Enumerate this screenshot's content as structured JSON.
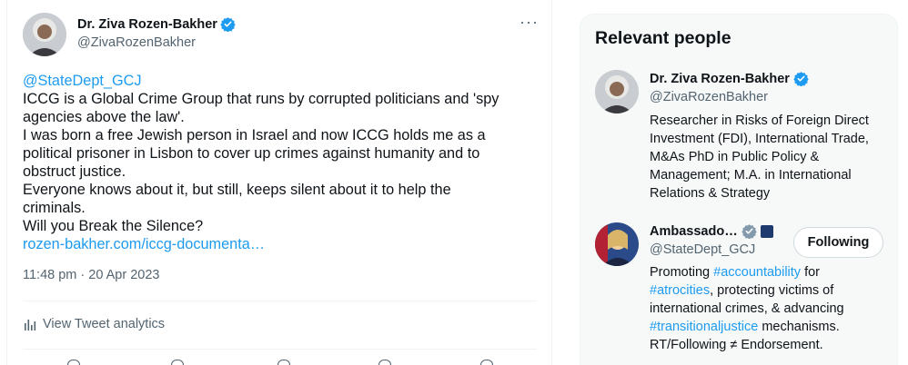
{
  "tweet": {
    "author_name": "Dr. Ziva Rozen-Bakher",
    "author_handle": "@ZivaRozenBakher",
    "more_label": "···",
    "lines": [
      {
        "text": "@StateDept_GCJ",
        "link": true
      },
      {
        "text": "ICCG is a Global Crime Group that runs by corrupted politicians and 'spy",
        "link": false
      },
      {
        "text": "agencies above the law'.",
        "link": false
      },
      {
        "text": "I was born a free Jewish person in Israel and now ICCG holds me as a",
        "link": false
      },
      {
        "text": "political prisoner in Lisbon to cover up crimes against humanity and to",
        "link": false
      },
      {
        "text": "obstruct justice.",
        "link": false
      },
      {
        "text": "Everyone knows about it, but still, keeps silent about it to help the",
        "link": false
      },
      {
        "text": "criminals.",
        "link": false
      },
      {
        "text": "Will you Break the Silence?",
        "link": false
      },
      {
        "text": "rozen-bakher.com/iccg-documenta…",
        "link": true
      }
    ],
    "timestamp": "11:48 pm · 20 Apr 2023",
    "analytics_label": "View Tweet analytics"
  },
  "relevant_people": {
    "title": "Relevant people",
    "people": [
      {
        "name": "Dr. Ziva Rozen-Bakher",
        "handle": "@ZivaRozenBakher",
        "bio_lines": [
          "Researcher in Risks of Foreign Direct",
          "Investment (FDI), International Trade,",
          "M&As PhD in Public Policy &",
          "Management; M.A. in International",
          "Relations & Strategy"
        ]
      },
      {
        "name": "Ambassado…",
        "handle": "@StateDept_GCJ",
        "follow_label": "Following",
        "bio_segments": [
          [
            {
              "t": "Promoting ",
              "h": false
            },
            {
              "t": "#accountability",
              "h": true
            },
            {
              "t": " for",
              "h": false
            }
          ],
          [
            {
              "t": "#atrocities",
              "h": true
            },
            {
              "t": ", protecting victims of",
              "h": false
            }
          ],
          [
            {
              "t": "international crimes, & advancing",
              "h": false
            }
          ],
          [
            {
              "t": "#transitionaljustice",
              "h": true
            },
            {
              "t": " mechanisms.",
              "h": false
            }
          ],
          [
            {
              "t": "RT/Following ≠ Endorsement.",
              "h": false
            }
          ]
        ]
      }
    ]
  },
  "colors": {
    "accent": "#1d9bf0",
    "text": "#0f1419",
    "muted": "#536471",
    "verified": "#1d9bf0",
    "gov_badge": "#829aab"
  },
  "icons": [
    "verified-badge-icon",
    "more-icon",
    "analytics-icon",
    "government-badge-icon",
    "flag-badge-icon"
  ]
}
